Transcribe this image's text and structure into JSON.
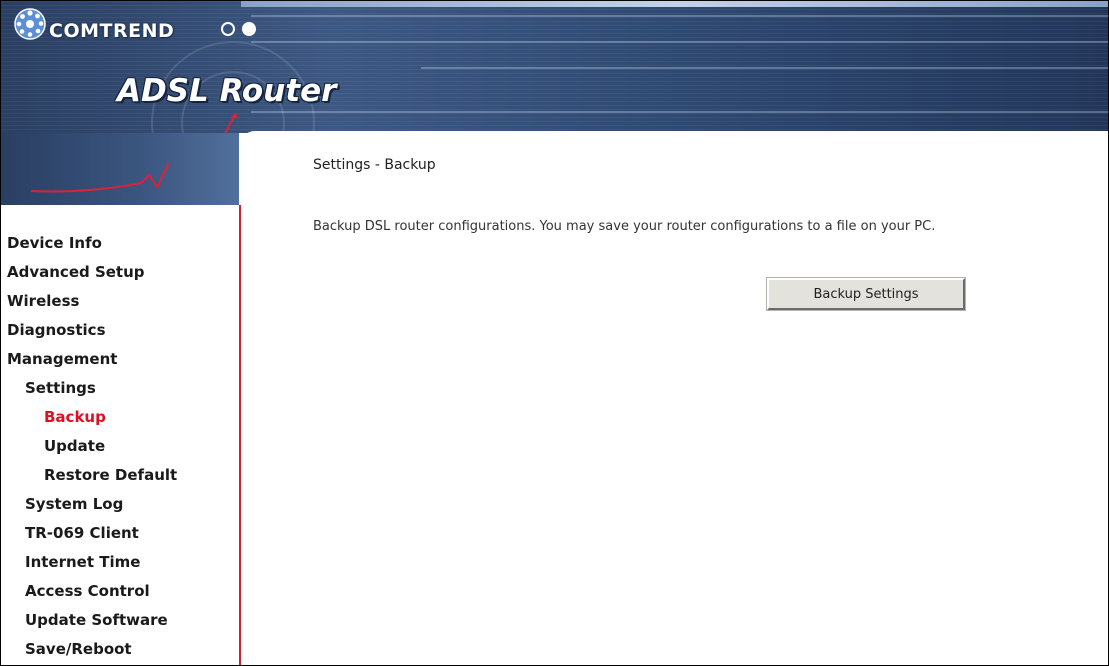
{
  "header": {
    "brand": "COMTREND",
    "product": "ADSL Router"
  },
  "sidebar": {
    "items": [
      {
        "label": "Device Info"
      },
      {
        "label": "Advanced Setup"
      },
      {
        "label": "Wireless"
      },
      {
        "label": "Diagnostics"
      },
      {
        "label": "Management"
      },
      {
        "label": "Settings"
      },
      {
        "label": "Backup"
      },
      {
        "label": "Update"
      },
      {
        "label": "Restore Default"
      },
      {
        "label": "System Log"
      },
      {
        "label": "TR-069 Client"
      },
      {
        "label": "Internet Time"
      },
      {
        "label": "Access Control"
      },
      {
        "label": "Update Software"
      },
      {
        "label": "Save/Reboot"
      }
    ],
    "active_color": "#dd1122"
  },
  "main": {
    "title": "Settings - Backup",
    "description": "Backup DSL router configurations. You may save your router configurations to a file on your PC.",
    "backup_button_label": "Backup Settings"
  }
}
